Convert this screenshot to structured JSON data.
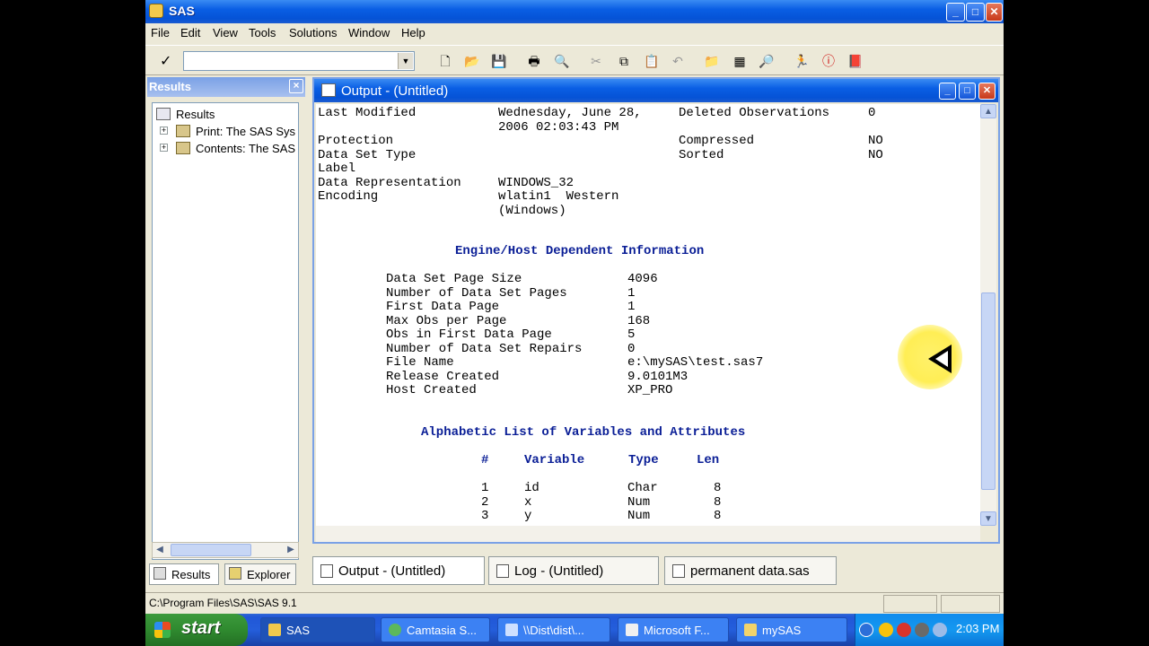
{
  "app": {
    "title": "SAS"
  },
  "menu": [
    "File",
    "Edit",
    "View",
    "Tools",
    "Solutions",
    "Window",
    "Help"
  ],
  "toolbar": {
    "command_value": ""
  },
  "results": {
    "header": "Results",
    "tree": [
      {
        "label": "Results"
      },
      {
        "label": "Print:  The SAS Sys"
      },
      {
        "label": "Contents:  The SAS"
      }
    ],
    "tabs": [
      "Results",
      "Explorer"
    ]
  },
  "output": {
    "title": "Output - (Untitled)",
    "attributes": [
      {
        "label": "Last Modified",
        "value": "Wednesday, June 28,",
        "label2": "Deleted Observations",
        "value2": "0"
      },
      {
        "label": "",
        "value": "2006 02:03:43 PM",
        "label2": "",
        "value2": ""
      },
      {
        "label": "Protection",
        "value": "",
        "label2": "Compressed",
        "value2": "NO"
      },
      {
        "label": "Data Set Type",
        "value": "",
        "label2": "Sorted",
        "value2": "NO"
      },
      {
        "label": "Label",
        "value": "",
        "label2": "",
        "value2": ""
      },
      {
        "label": "Data Representation",
        "value": "WINDOWS_32",
        "label2": "",
        "value2": ""
      },
      {
        "label": "Encoding",
        "value": "wlatin1  Western",
        "label2": "",
        "value2": ""
      },
      {
        "label": "",
        "value": "(Windows)",
        "label2": "",
        "value2": ""
      }
    ],
    "engine_heading": "Engine/Host Dependent Information",
    "engine": [
      {
        "label": "Data Set Page Size",
        "value": "4096"
      },
      {
        "label": "Number of Data Set Pages",
        "value": "1"
      },
      {
        "label": "First Data Page",
        "value": "1"
      },
      {
        "label": "Max Obs per Page",
        "value": "168"
      },
      {
        "label": "Obs in First Data Page",
        "value": "5"
      },
      {
        "label": "Number of Data Set Repairs",
        "value": "0"
      },
      {
        "label": "File Name",
        "value": "e:\\mySAS\\test.sas7"
      },
      {
        "label": "Release Created",
        "value": "9.0101M3"
      },
      {
        "label": "Host Created",
        "value": "XP_PRO"
      }
    ],
    "vars_heading": "Alphabetic List of Variables and Attributes",
    "vars_columns": [
      "#",
      "Variable",
      "Type",
      "Len"
    ],
    "vars": [
      {
        "num": "1",
        "name": "id",
        "type": "Char",
        "len": "8"
      },
      {
        "num": "2",
        "name": "x",
        "type": "Num",
        "len": "8"
      },
      {
        "num": "3",
        "name": "y",
        "type": "Num",
        "len": "8"
      }
    ]
  },
  "window_tabs": [
    "Output - (Untitled)",
    "Log - (Untitled)",
    "permanent data.sas"
  ],
  "status": {
    "path": "C:\\Program Files\\SAS\\SAS 9.1"
  },
  "taskbar": {
    "start": "start",
    "tasks": [
      "SAS",
      "Camtasia S...",
      "\\\\Dist\\dist\\...",
      "Microsoft F...",
      "mySAS"
    ],
    "clock": "2:03 PM"
  }
}
